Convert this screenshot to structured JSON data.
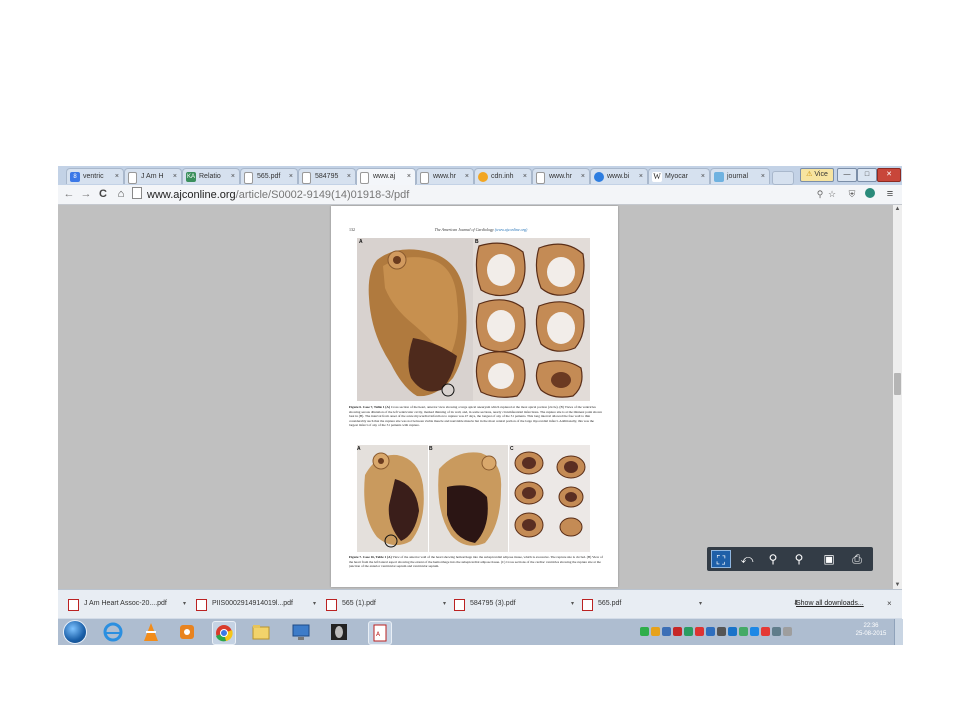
{
  "browser": {
    "tabs": [
      {
        "label": "ventric",
        "favicon": "google-icon",
        "color": "#3b78e7"
      },
      {
        "label": "J Am H",
        "favicon": "page-icon",
        "color": "#ffffff"
      },
      {
        "label": "Relatio",
        "favicon": "ka-icon",
        "color": "#3a8f5c"
      },
      {
        "label": "565.pdf",
        "favicon": "page-icon",
        "color": "#ffffff"
      },
      {
        "label": "584795",
        "favicon": "page-icon",
        "color": "#ffffff"
      },
      {
        "label": "www.aj",
        "favicon": "page-icon",
        "color": "#ffffff"
      },
      {
        "label": "www.hr",
        "favicon": "page-icon",
        "color": "#ffffff"
      },
      {
        "label": "cdn.inh",
        "favicon": "globe-icon",
        "color": "#f2a623"
      },
      {
        "label": "www.hr",
        "favicon": "page-icon",
        "color": "#ffffff"
      },
      {
        "label": "www.bi",
        "favicon": "chrome-icon",
        "color": "#2d7de0"
      },
      {
        "label": "Myocar",
        "favicon": "wikipedia-icon",
        "color": "#ffffff"
      },
      {
        "label": "journal",
        "favicon": "stack-icon",
        "color": "#6fb2e0"
      }
    ],
    "tab_close": "×",
    "window_buttons": {
      "user": "Vice",
      "minimize": "—",
      "maximize": "□",
      "close": "✕"
    },
    "url": {
      "domain": "www.ajconline.org",
      "path": "/article/S0002-9149(14)01918-3/pdf"
    }
  },
  "pdf": {
    "page_number": "132",
    "running_head": "The American Journal of Cardiology",
    "running_head_link": "(www.ajconline.org)",
    "figure6": {
      "panel_a": "A",
      "panel_b": "B",
      "caption_lead": "Figure 6. Case 7, Table 1 (A)",
      "caption_body": "Cross section of the heart, anterior view showing a large apical aneurysm which ruptured at the most apical portion (circle). (B) Views of the ventricles showing serous dilatation of the left ventricular cavity, marked thinning of its wall, and, in some sections, nearly circumferential infarctions. The rupture site is at the thinnest point shown best in (B). The interval from onset of the acute myocardial infarction to rupture was 47 days, the longest of any of the 31 patients. This long interval allowed the free wall to thin considerably such that the rupture site was not between viable muscle and nonviable muscle but in the most central portion of the large myocardial infarct. Additionally, this was the largest infarct of any of the 31 patients with rupture."
    },
    "figure7": {
      "panel_a": "A",
      "panel_b": "B",
      "panel_c": "C",
      "caption_lead": "Figure 7. Case 16, Table 1 (A)",
      "caption_body": "View of the anterior wall of the heart showing hemorrhage into the subepicardial adipose tissue, which is excessive. The rupture site is circled. (B) View of the heart from the left lateral aspect showing the extent of the hemorrhage into the subepicardial adipose tissue. (C) Cross sections of the cardiac ventricles showing the rupture site at the junction of the anterior ventricular septum and ventricular septum."
    }
  },
  "pdf_toolbar": [
    "fit-page-icon",
    "rotate-icon",
    "zoom-out-icon",
    "zoom-in-icon",
    "save-icon",
    "print-icon"
  ],
  "downloads": {
    "items": [
      {
        "label": "J Am Heart Assoc-20....pdf"
      },
      {
        "label": "PIIS0002914914019l...pdf"
      },
      {
        "label": "565 (1).pdf"
      },
      {
        "label": "584795 (3).pdf"
      },
      {
        "label": "565.pdf"
      }
    ],
    "show_all": "Show all downloads...",
    "close": "×"
  },
  "taskbar": {
    "apps": [
      "ie-icon",
      "vlc-icon",
      "media-player-icon",
      "chrome-icon",
      "file-explorer-icon",
      "remote-desktop-icon",
      "xray-viewer-icon",
      "pdf-reader-icon"
    ],
    "clock_time": "22:36",
    "clock_date": "25-08-2015"
  }
}
